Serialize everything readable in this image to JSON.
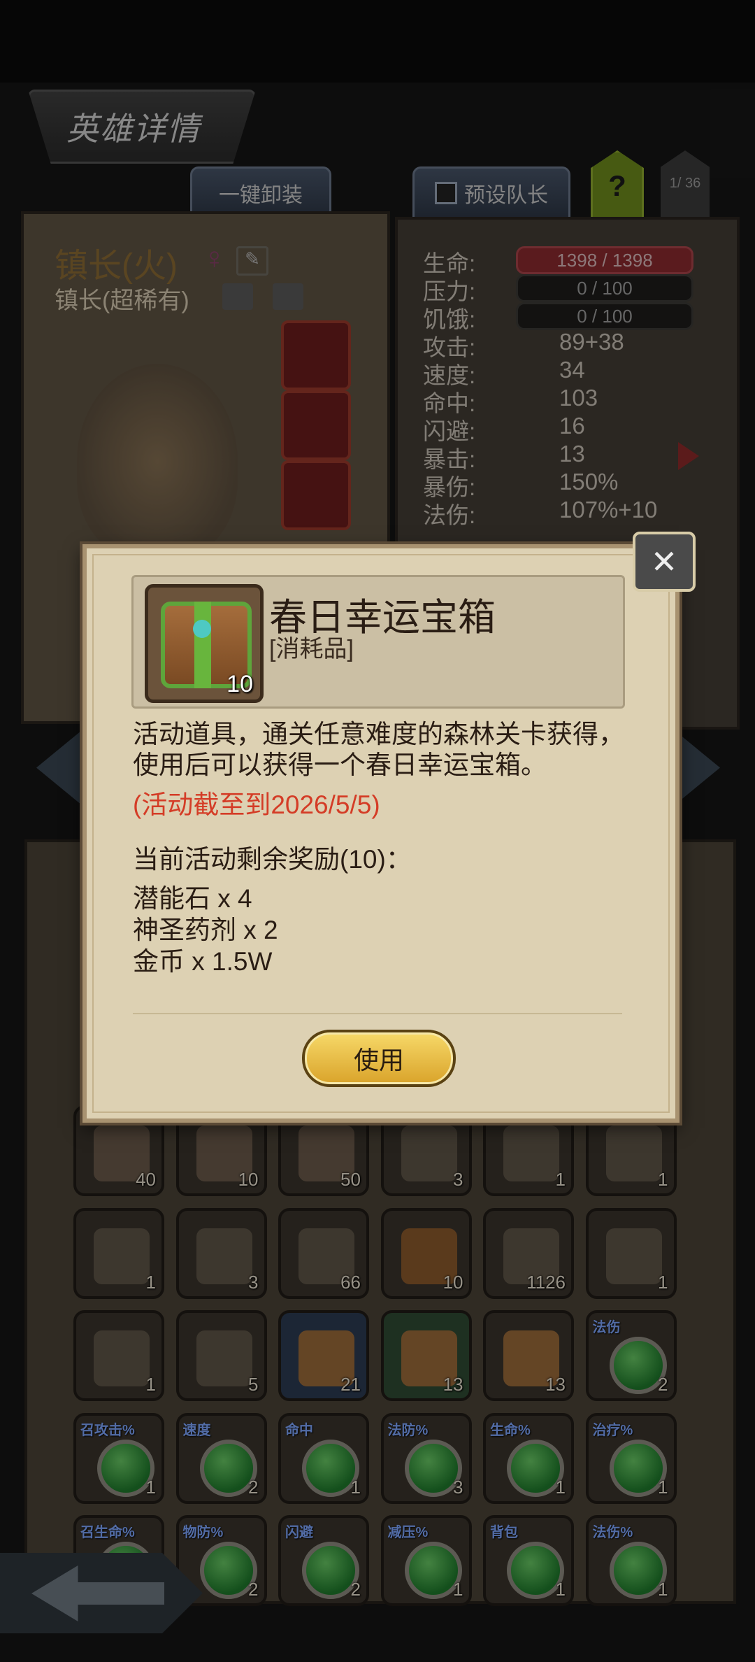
{
  "header": {
    "title": "英雄详情",
    "unequip_all": "一键卸装",
    "preset_leader": "预设队长",
    "help": "?",
    "page_indicator": "1/ 36"
  },
  "hero": {
    "name": "镇长(火)",
    "rarity": "镇长(超稀有)"
  },
  "stats": [
    {
      "label": "生命:",
      "value": "1398 / 1398",
      "kind": "bar-red"
    },
    {
      "label": "压力:",
      "value": "0 / 100",
      "kind": "bar"
    },
    {
      "label": "饥饿:",
      "value": "0 / 100",
      "kind": "bar"
    },
    {
      "label": "攻击:",
      "value": "89+38"
    },
    {
      "label": "速度:",
      "value": "34"
    },
    {
      "label": "命中:",
      "value": "103"
    },
    {
      "label": "闪避:",
      "value": "16"
    },
    {
      "label": "暴击:",
      "value": "13"
    },
    {
      "label": "暴伤:",
      "value": "150%"
    },
    {
      "label": "法伤:",
      "value": "107%+10"
    }
  ],
  "modal": {
    "item_name": "春日幸运宝箱",
    "item_type": "[消耗品]",
    "item_count": "10",
    "description": "活动道具，通关任意难度的森林关卡获得，使用后可以获得一个春日幸运宝箱。",
    "deadline": "(活动截至到2026/5/5)",
    "rewards_header": "当前活动剩余奖励(10)：",
    "rewards": [
      "潜能石 x 4",
      "神圣药剂 x 2",
      "金币 x 1.5W"
    ],
    "use_label": "使用"
  },
  "inventory_rows": [
    [
      {
        "count": "40",
        "tag": "",
        "kind": "hero"
      },
      {
        "count": "10",
        "tag": "",
        "kind": "hero"
      },
      {
        "count": "50",
        "tag": "",
        "kind": "hero"
      },
      {
        "count": "3",
        "tag": "",
        "kind": "item"
      },
      {
        "count": "1",
        "tag": "",
        "kind": "item"
      },
      {
        "count": "1",
        "tag": "",
        "kind": "item"
      }
    ],
    [
      {
        "count": "1",
        "tag": "",
        "kind": "item"
      },
      {
        "count": "3",
        "tag": "",
        "kind": "item"
      },
      {
        "count": "66",
        "tag": "",
        "kind": "item"
      },
      {
        "count": "10",
        "tag": "",
        "kind": "chest"
      },
      {
        "count": "1126",
        "tag": "",
        "kind": "item"
      },
      {
        "count": "1",
        "tag": "",
        "kind": "item"
      }
    ],
    [
      {
        "count": "1",
        "tag": "",
        "kind": "item"
      },
      {
        "count": "5",
        "tag": "",
        "kind": "item"
      },
      {
        "count": "21",
        "tag": "",
        "kind": "box"
      },
      {
        "count": "13",
        "tag": "",
        "kind": "box"
      },
      {
        "count": "13",
        "tag": "",
        "kind": "box"
      },
      {
        "count": "2",
        "tag": "法伤",
        "kind": "gem"
      }
    ],
    [
      {
        "count": "1",
        "tag": "召攻击%",
        "kind": "gem"
      },
      {
        "count": "2",
        "tag": "速度",
        "kind": "gem"
      },
      {
        "count": "1",
        "tag": "命中",
        "kind": "gem"
      },
      {
        "count": "3",
        "tag": "法防%",
        "kind": "gem"
      },
      {
        "count": "1",
        "tag": "生命%",
        "kind": "gem"
      },
      {
        "count": "1",
        "tag": "治疗%",
        "kind": "gem"
      }
    ],
    [
      {
        "count": "",
        "tag": "召生命%",
        "kind": "gem"
      },
      {
        "count": "2",
        "tag": "物防%",
        "kind": "gem"
      },
      {
        "count": "2",
        "tag": "闪避",
        "kind": "gem"
      },
      {
        "count": "1",
        "tag": "减压%",
        "kind": "gem"
      },
      {
        "count": "1",
        "tag": "背包",
        "kind": "gem"
      },
      {
        "count": "1",
        "tag": "法伤%",
        "kind": "gem"
      }
    ]
  ],
  "colors": {
    "accent_red": "#d43c26",
    "use_button": "#e8b93c",
    "help_button": "#6e8a1c"
  }
}
